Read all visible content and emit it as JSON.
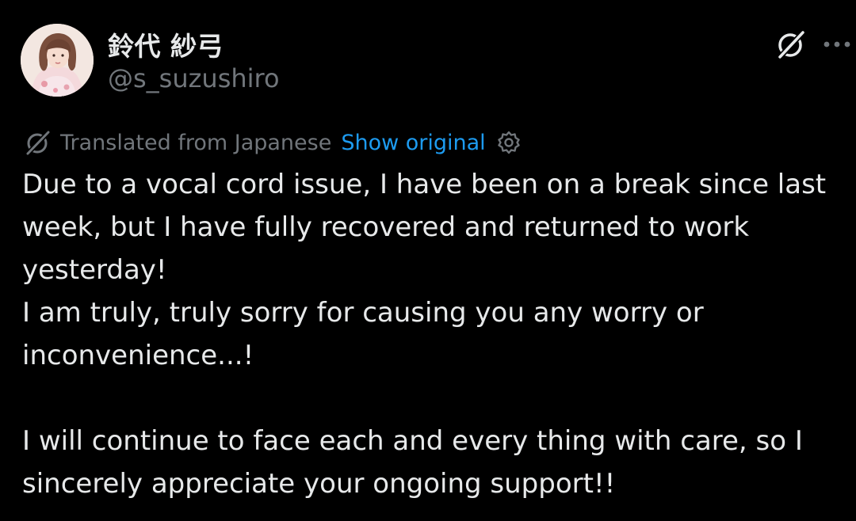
{
  "author": {
    "display_name": "鈴代 紗弓",
    "handle": "@s_suzushiro",
    "avatar_icon": "profile-photo"
  },
  "header_actions": {
    "grok_icon": "grok-icon",
    "more_icon": "more-icon"
  },
  "translation": {
    "label": "Translated from Japanese",
    "show_original": "Show original",
    "settings_icon": "gear-icon"
  },
  "tweet": {
    "paragraph_1": "Due to a vocal cord issue, I have been on a break since last week, but I have fully recovered and returned to work yesterday!",
    "paragraph_2": "I am truly, truly sorry for causing you any worry or inconvenience...!",
    "paragraph_3": "I will continue to face each and every thing with care, so I sincerely appreciate your ongoing support!!"
  },
  "colors": {
    "background": "#000000",
    "text": "#e7e9ea",
    "secondary": "#71767b",
    "link": "#1d9bf0"
  }
}
